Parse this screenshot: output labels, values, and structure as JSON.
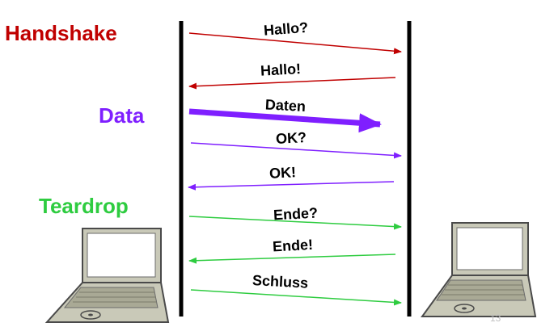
{
  "phases": [
    {
      "label": "Handshake",
      "color": "#c00000"
    },
    {
      "label": "Data",
      "color": "#7f1fff"
    },
    {
      "label": "Teardrop",
      "color": "#2ecc40"
    }
  ],
  "messages": [
    {
      "label": "Hallo?",
      "direction": "right",
      "phase": "Handshake",
      "color": "#c00000",
      "emphasis": false
    },
    {
      "label": "Hallo!",
      "direction": "left",
      "phase": "Handshake",
      "color": "#c00000",
      "emphasis": false
    },
    {
      "label": "Daten",
      "direction": "right",
      "phase": "Data",
      "color": "#7f1fff",
      "emphasis": true
    },
    {
      "label": "OK?",
      "direction": "right",
      "phase": "Data",
      "color": "#7f1fff",
      "emphasis": false
    },
    {
      "label": "OK!",
      "direction": "left",
      "phase": "Data",
      "color": "#7f1fff",
      "emphasis": false
    },
    {
      "label": "Ende?",
      "direction": "right",
      "phase": "Teardrop",
      "color": "#2ecc40",
      "emphasis": false
    },
    {
      "label": "Ende!",
      "direction": "left",
      "phase": "Teardrop",
      "color": "#2ecc40",
      "emphasis": false
    },
    {
      "label": "Schluss",
      "direction": "right",
      "phase": "Teardrop",
      "color": "#2ecc40",
      "emphasis": false
    }
  ],
  "endpoints": [
    {
      "icon": "laptop-icon",
      "side": "left"
    },
    {
      "icon": "laptop-icon",
      "side": "right"
    }
  ],
  "page_number": "13",
  "colors": {
    "lifeline": "#000000",
    "laptop_body": "#c9c9b8",
    "laptop_outline": "#4a4a4a"
  }
}
